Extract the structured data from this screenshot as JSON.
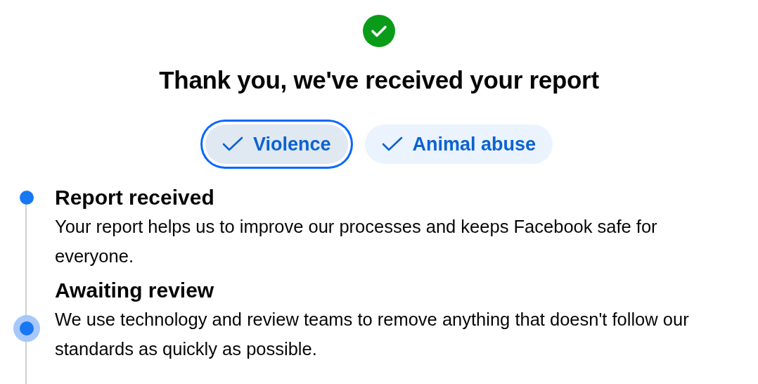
{
  "title": "Thank you, we've received your report",
  "chips": [
    {
      "label": "Violence",
      "selected": true
    },
    {
      "label": "Animal abuse",
      "selected": false
    }
  ],
  "steps": [
    {
      "heading": "Report received",
      "description": "Your report helps us to improve our processes and keeps Facebook safe for everyone.",
      "current": false
    },
    {
      "heading": "Awaiting review",
      "description": "We use technology and review teams to remove anything that doesn't follow our standards as quickly as possible.",
      "current": true
    }
  ]
}
